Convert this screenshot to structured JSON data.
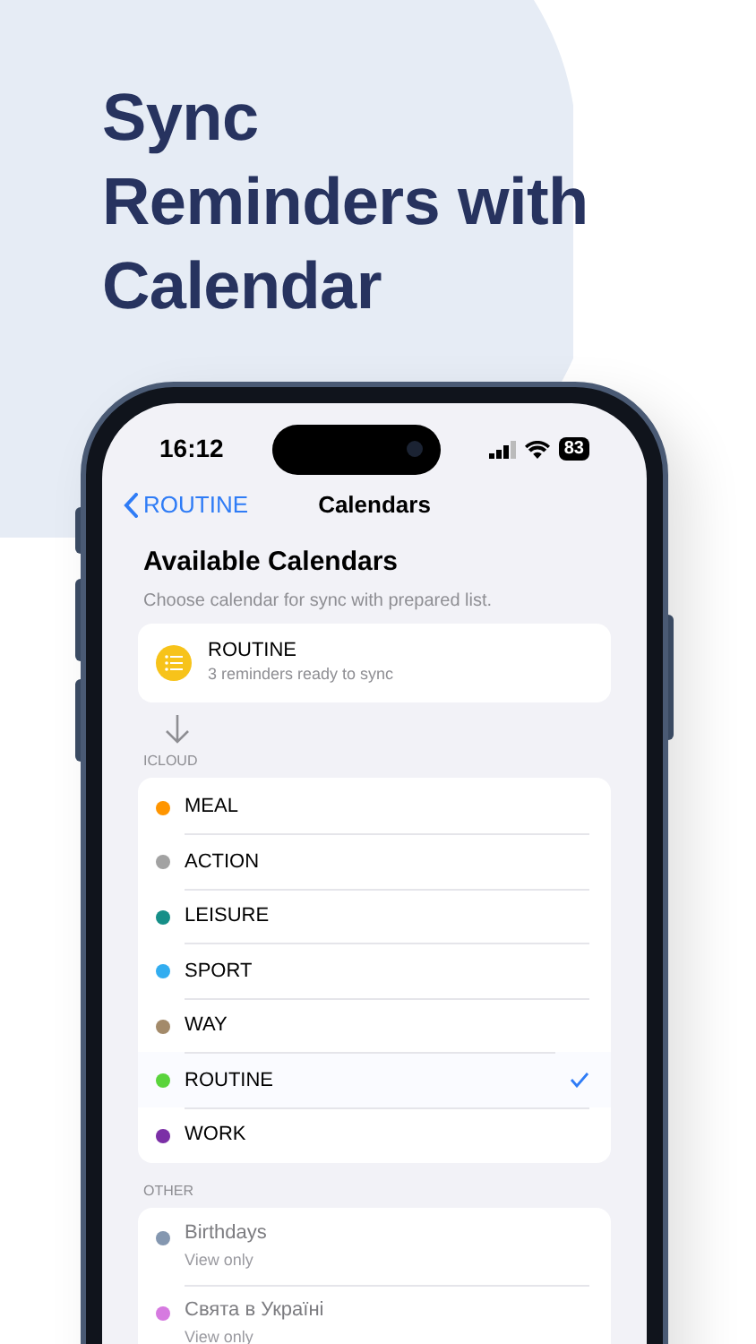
{
  "headline": "Sync\nReminders with\nCalendar",
  "status_bar": {
    "time": "16:12",
    "battery": "83"
  },
  "nav": {
    "back": "ROUTINE",
    "title": "Calendars"
  },
  "section": {
    "title": "Available Calendars",
    "subtitle": "Choose calendar for sync with prepared list."
  },
  "source": {
    "title": "ROUTINE",
    "subtitle": "3 reminders ready to sync"
  },
  "groups": [
    {
      "header": "ICLOUD",
      "items": [
        {
          "name": "MEAL",
          "color": "#ff9500",
          "selected": false
        },
        {
          "name": "ACTION",
          "color": "#a2a2a2",
          "selected": false
        },
        {
          "name": "LEISURE",
          "color": "#168f88",
          "selected": false
        },
        {
          "name": "SPORT",
          "color": "#32adf0",
          "selected": false
        },
        {
          "name": "WAY",
          "color": "#a38a6a",
          "selected": false
        },
        {
          "name": "ROUTINE",
          "color": "#5ad43c",
          "selected": true
        },
        {
          "name": "WORK",
          "color": "#7b2fa6",
          "selected": false
        }
      ]
    },
    {
      "header": "OTHER",
      "items": [
        {
          "name": "Birthdays",
          "detail": "View only",
          "color": "#8497b0",
          "disabled": true
        },
        {
          "name": "Свята в Україні",
          "detail": "View only",
          "color": "#d67ae0",
          "disabled": true
        }
      ]
    }
  ]
}
